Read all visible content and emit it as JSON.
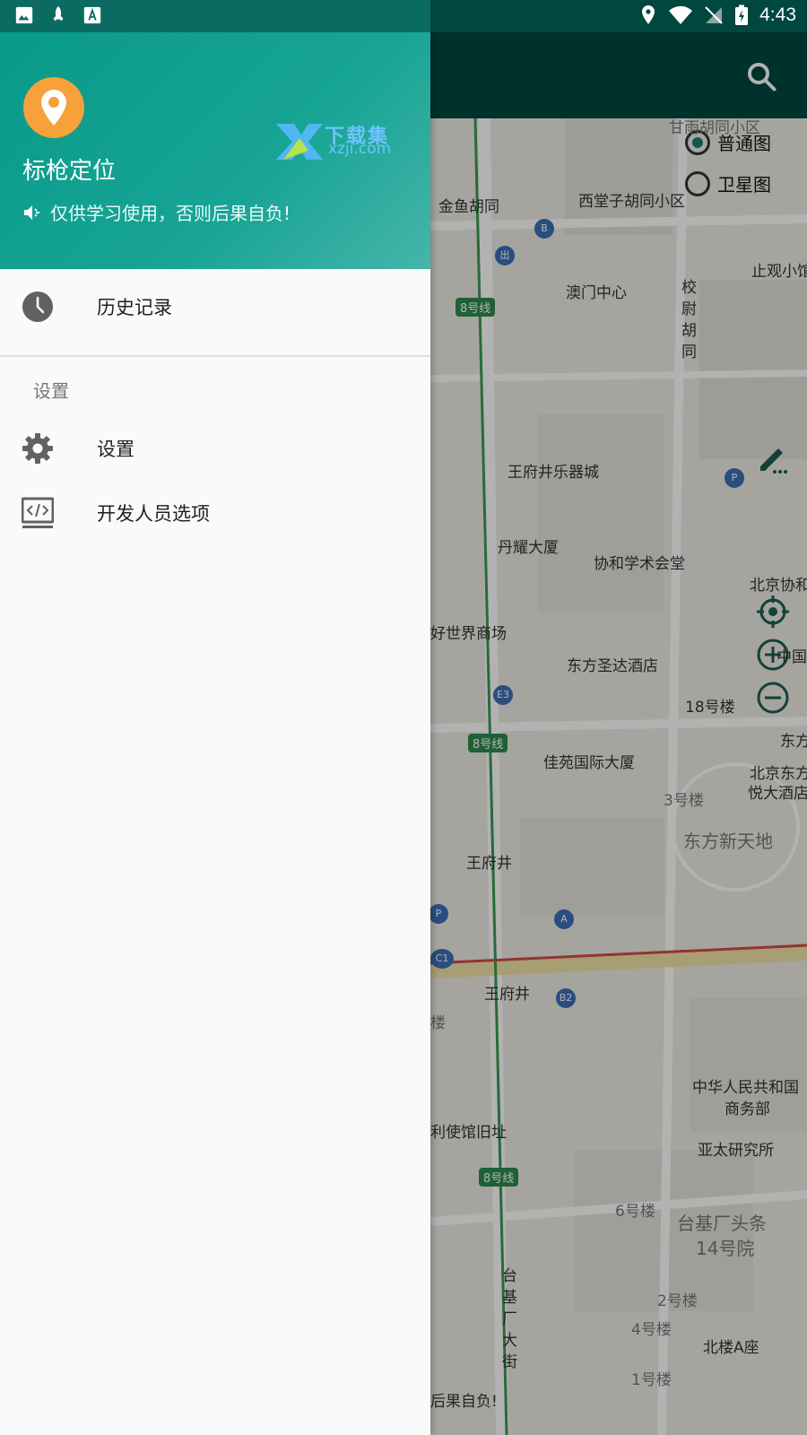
{
  "status_bar": {
    "time": "4:43",
    "left_icons": [
      "image-icon",
      "rocket-icon",
      "text-a-icon"
    ],
    "right_icons": [
      "location-icon",
      "wifi-icon",
      "no-signal-icon",
      "battery-charging-icon"
    ]
  },
  "drawer": {
    "app_title": "标枪定位",
    "notice": "仅供学习使用，否则后果自负!",
    "watermark_top": "下载集",
    "watermark_bottom": "xzji.com",
    "history_label": "历史记录",
    "section_title": "设置",
    "settings_label": "设置",
    "developer_label": "开发人员选项"
  },
  "map": {
    "radio_normal": "普通图",
    "radio_satellite": "卫星图",
    "selected": "普通图",
    "labels": [
      {
        "text": "甘雨胡同小区",
        "cls": "light"
      },
      {
        "text": "金鱼胡同",
        "cls": ""
      },
      {
        "text": "西堂子胡同小区",
        "cls": ""
      },
      {
        "text": "止观小馆",
        "cls": ""
      },
      {
        "text": "澳门中心",
        "cls": ""
      },
      {
        "text": "校",
        "cls": ""
      },
      {
        "text": "尉",
        "cls": ""
      },
      {
        "text": "胡",
        "cls": ""
      },
      {
        "text": "同",
        "cls": ""
      },
      {
        "text": "王府井乐器城",
        "cls": ""
      },
      {
        "text": "丹耀大厦",
        "cls": ""
      },
      {
        "text": "协和学术会堂",
        "cls": ""
      },
      {
        "text": "北京协和",
        "cls": ""
      },
      {
        "text": "好世界商场",
        "cls": ""
      },
      {
        "text": "东方圣达酒店",
        "cls": ""
      },
      {
        "text": "18号楼",
        "cls": ""
      },
      {
        "text": "中国",
        "cls": ""
      },
      {
        "text": "东方",
        "cls": ""
      },
      {
        "text": "佳苑国际大厦",
        "cls": ""
      },
      {
        "text": "北京东方",
        "cls": ""
      },
      {
        "text": "悦大酒店",
        "cls": ""
      },
      {
        "text": "3号楼",
        "cls": "light"
      },
      {
        "text": "东方新天地",
        "cls": "big"
      },
      {
        "text": "王府井",
        "cls": ""
      },
      {
        "text": "王府井",
        "cls": ""
      },
      {
        "text": "楼",
        "cls": "light"
      },
      {
        "text": "中华人民共和国",
        "cls": ""
      },
      {
        "text": "商务部",
        "cls": ""
      },
      {
        "text": "亚太研究所",
        "cls": ""
      },
      {
        "text": "利使馆旧址",
        "cls": ""
      },
      {
        "text": "6号楼",
        "cls": "light"
      },
      {
        "text": "台基厂头条",
        "cls": "big"
      },
      {
        "text": "14号院",
        "cls": "big"
      },
      {
        "text": "台",
        "cls": ""
      },
      {
        "text": "基",
        "cls": ""
      },
      {
        "text": "厂",
        "cls": ""
      },
      {
        "text": "大",
        "cls": ""
      },
      {
        "text": "街",
        "cls": ""
      },
      {
        "text": "2号楼",
        "cls": "light"
      },
      {
        "text": "4号楼",
        "cls": "light"
      },
      {
        "text": "北楼A座",
        "cls": ""
      },
      {
        "text": "1号楼",
        "cls": "light"
      },
      {
        "text": "后果自负!",
        "cls": ""
      }
    ],
    "line_tags": [
      "8号线",
      "8号线",
      "8号线"
    ],
    "poi_letters": [
      "B",
      "出",
      "A",
      "C1",
      "B2",
      "E3",
      "P",
      "P"
    ]
  }
}
